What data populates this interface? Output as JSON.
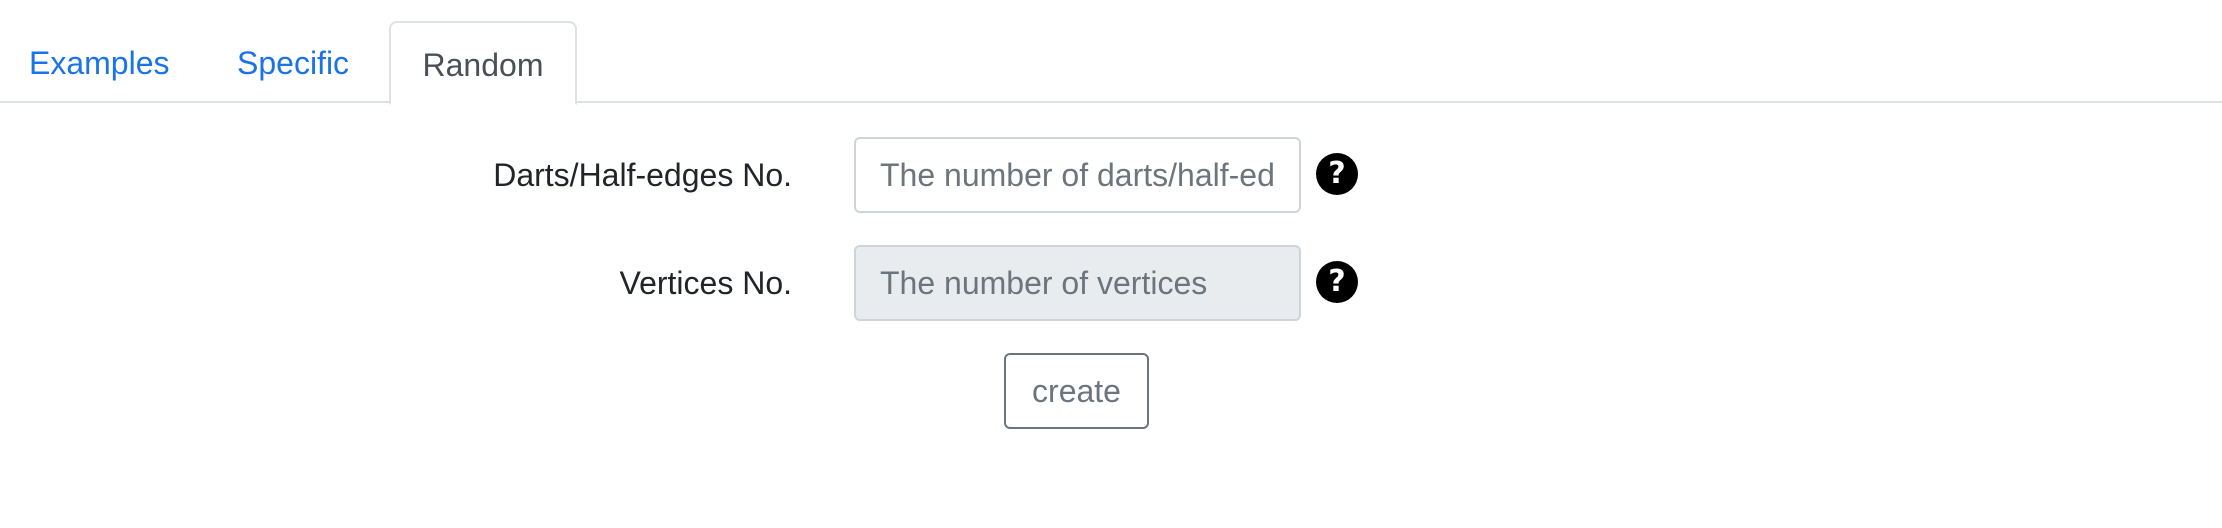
{
  "tabs": [
    {
      "label": "Examples",
      "active": false
    },
    {
      "label": "Specific",
      "active": false
    },
    {
      "label": "Random",
      "active": true
    }
  ],
  "form": {
    "darts": {
      "label": "Darts/Half-edges No.",
      "placeholder": "The number of darts/half-edges",
      "value": "",
      "help_icon": "question-circle-icon"
    },
    "vertices": {
      "label": "Vertices No.",
      "placeholder": "The number of vertices",
      "value": "",
      "disabled": true,
      "help_icon": "question-circle-icon"
    },
    "create_label": "create"
  },
  "colors": {
    "link": "#1a73e8",
    "active_tab_text": "#495057",
    "border": "#dee2e6",
    "disabled_input_bg": "#e9ecef",
    "help_icon_bg": "#000000",
    "button_text": "#6c757d"
  },
  "help_glyph": "?"
}
